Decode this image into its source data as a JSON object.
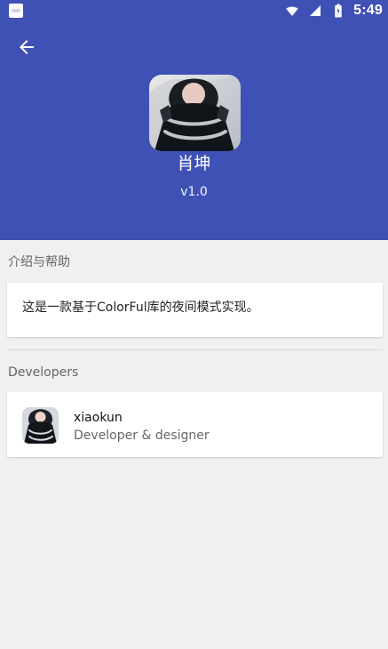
{
  "status_bar": {
    "time": "5:49",
    "icons": [
      "notification-icon",
      "wifi-icon",
      "signal-icon",
      "battery-icon"
    ]
  },
  "header": {
    "back_icon": "arrow-left-icon",
    "app_name": "肖坤",
    "app_version": "v1.0",
    "background_color": "#3f51b5"
  },
  "sections": {
    "intro": {
      "title": "介绍与帮助",
      "text": "这是一款基于ColorFul库的夜间模式实现。"
    },
    "developers": {
      "title": "Developers",
      "items": [
        {
          "name": "xiaokun",
          "role": "Developer & designer"
        }
      ]
    }
  }
}
